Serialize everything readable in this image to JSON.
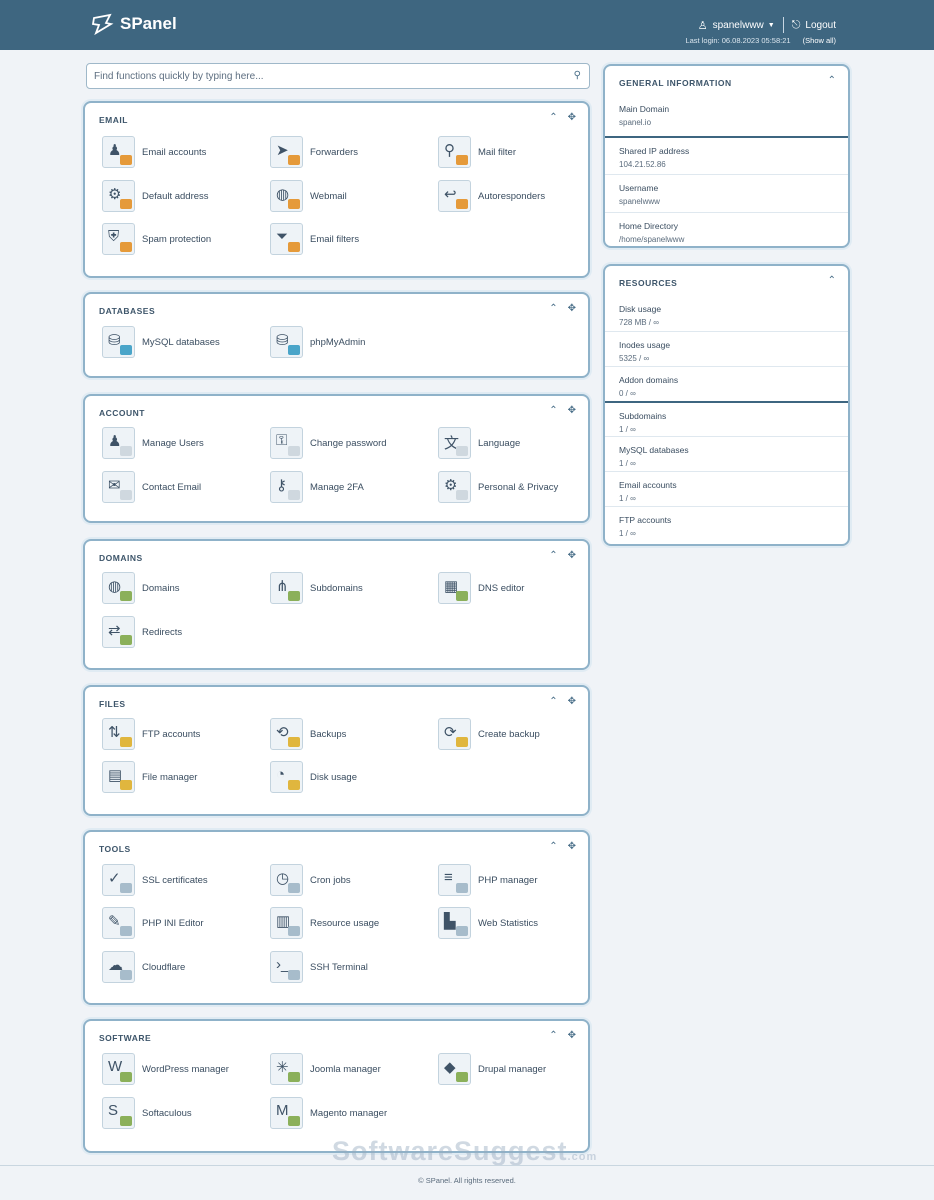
{
  "header": {
    "logo_text": "SPanel",
    "username": "spanelwww",
    "logout_label": "Logout",
    "last_login": "Last login: 06.08.2023 05:58:21",
    "last_login_link": "(Show all)"
  },
  "search": {
    "placeholder": "Find functions quickly by typing here..."
  },
  "sections": [
    {
      "title": "Email",
      "items": [
        {
          "label": "Email accounts",
          "icon": "user-icon",
          "badge": "#e59a3a"
        },
        {
          "label": "Forwarders",
          "icon": "forward-icon",
          "badge": "#e59a3a"
        },
        {
          "label": "Mail filter",
          "icon": "filter-icon",
          "badge": "#e59a3a"
        },
        {
          "label": "Default address",
          "icon": "gear-icon",
          "badge": "#e59a3a"
        },
        {
          "label": "Webmail",
          "icon": "globe-icon",
          "badge": "#e59a3a"
        },
        {
          "label": "Autoresponders",
          "icon": "autoreply-icon",
          "badge": "#e59a3a"
        },
        {
          "label": "Spam protection",
          "icon": "shield-icon",
          "badge": "#e59a3a"
        },
        {
          "label": "Email filters",
          "icon": "funnel-icon",
          "badge": "#e59a3a"
        }
      ]
    },
    {
      "title": "Databases",
      "items": [
        {
          "label": "MySQL databases",
          "icon": "database-icon",
          "badge": "#4aa5c9"
        },
        {
          "label": "phpMyAdmin",
          "icon": "database-admin-icon",
          "badge": "#4aa5c9"
        }
      ]
    },
    {
      "title": "Account",
      "items": [
        {
          "label": "Manage Users",
          "icon": "users-icon",
          "badge": "#cfd8df"
        },
        {
          "label": "Change password",
          "icon": "lock-icon",
          "badge": "#cfd8df"
        },
        {
          "label": "Language",
          "icon": "language-icon",
          "badge": "#cfd8df"
        },
        {
          "label": "Contact Email",
          "icon": "mail-icon",
          "badge": "#cfd8df"
        },
        {
          "label": "Manage 2FA",
          "icon": "two-factor-icon",
          "badge": "#cfd8df"
        },
        {
          "label": "Personal & Privacy",
          "icon": "privacy-icon",
          "badge": "#cfd8df"
        }
      ]
    },
    {
      "title": "Domains",
      "items": [
        {
          "label": "Domains",
          "icon": "globe-icon",
          "badge": "#8bb05a"
        },
        {
          "label": "Subdomains",
          "icon": "subdomain-icon",
          "badge": "#8bb05a"
        },
        {
          "label": "DNS editor",
          "icon": "dns-icon",
          "badge": "#8bb05a"
        },
        {
          "label": "Redirects",
          "icon": "redirect-icon",
          "badge": "#8bb05a"
        }
      ]
    },
    {
      "title": "Files",
      "items": [
        {
          "label": "FTP accounts",
          "icon": "ftp-icon",
          "badge": "#e0b63e"
        },
        {
          "label": "Backups",
          "icon": "backup-icon",
          "badge": "#e0b63e"
        },
        {
          "label": "Create backup",
          "icon": "create-backup-icon",
          "badge": "#e0b63e"
        },
        {
          "label": "File manager",
          "icon": "file-manager-icon",
          "badge": "#e0b63e"
        },
        {
          "label": "Disk usage",
          "icon": "disk-icon",
          "badge": "#e0b63e"
        }
      ]
    },
    {
      "title": "Tools",
      "items": [
        {
          "label": "SSL certificates",
          "icon": "certificate-icon",
          "badge": "#a7bccb"
        },
        {
          "label": "Cron jobs",
          "icon": "cron-icon",
          "badge": "#a7bccb"
        },
        {
          "label": "PHP manager",
          "icon": "php-icon",
          "badge": "#a7bccb"
        },
        {
          "label": "PHP INI Editor",
          "icon": "php-ini-icon",
          "badge": "#a7bccb"
        },
        {
          "label": "Resource usage",
          "icon": "resource-icon",
          "badge": "#a7bccb"
        },
        {
          "label": "Web Statistics",
          "icon": "statistics-icon",
          "badge": "#a7bccb"
        },
        {
          "label": "Cloudflare",
          "icon": "cloud-icon",
          "badge": "#a7bccb"
        },
        {
          "label": "SSH Terminal",
          "icon": "terminal-icon",
          "badge": "#a7bccb"
        }
      ]
    },
    {
      "title": "Software",
      "items": [
        {
          "label": "WordPress manager",
          "icon": "wordpress-icon",
          "badge": "#8bb05a"
        },
        {
          "label": "Joomla manager",
          "icon": "joomla-icon",
          "badge": "#8bb05a"
        },
        {
          "label": "Drupal manager",
          "icon": "drupal-icon",
          "badge": "#8bb05a"
        },
        {
          "label": "Softaculous",
          "icon": "softaculous-icon",
          "badge": "#8bb05a"
        },
        {
          "label": "Magento manager",
          "icon": "magento-icon",
          "badge": "#8bb05a"
        }
      ]
    }
  ],
  "general_info": {
    "title": "General Information",
    "rows": [
      {
        "label": "Main Domain",
        "value": "spanel.io"
      },
      {
        "label": "Shared IP address",
        "value": "104.21.52.86"
      },
      {
        "label": "Username",
        "value": "spanelwww"
      },
      {
        "label": "Home Directory",
        "value": "/home/spanelwww"
      }
    ]
  },
  "resources": {
    "title": "Resources",
    "rows": [
      {
        "label": "Disk usage",
        "value": "728 MB / ∞"
      },
      {
        "label": "Inodes usage",
        "value": "5325 / ∞"
      },
      {
        "label": "Addon domains",
        "value": "0 / ∞"
      },
      {
        "label": "Subdomains",
        "value": "1 / ∞"
      },
      {
        "label": "MySQL databases",
        "value": "1 / ∞"
      },
      {
        "label": "Email accounts",
        "value": "1 / ∞"
      },
      {
        "label": "FTP accounts",
        "value": "1 / ∞"
      }
    ]
  },
  "controls": {
    "collapse_glyph": "⌃",
    "settings_glyph": "✥",
    "search_glyph": "⚲",
    "user_glyph": "♙",
    "logout_glyph": "⎋"
  },
  "watermark": {
    "main": "SoftwareSuggest",
    "suffix": ".com"
  },
  "footer": {
    "text": "© SPanel. All rights reserved."
  }
}
